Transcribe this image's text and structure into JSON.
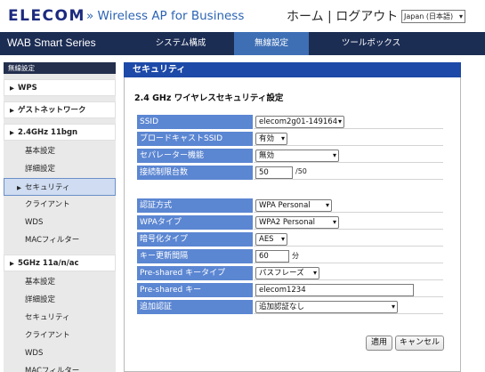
{
  "header": {
    "logo": "ELECOM",
    "product": "» Wireless AP for Business",
    "home": "ホーム",
    "separator": "|",
    "logout": "ログアウト",
    "language": "Japan (日本語)"
  },
  "nav": {
    "series": "WAB Smart Series",
    "tabs": [
      "システム構成",
      "無線設定",
      "ツールボックス"
    ],
    "active_tab": "無線設定"
  },
  "sidebar": {
    "title": "無線設定",
    "wps": "WPS",
    "guest": "ゲストネットワーク",
    "band24": "2.4GHz 11bgn",
    "band24_items": [
      "基本設定",
      "詳細設定",
      "セキュリティ",
      "クライアント",
      "WDS",
      "MACフィルター"
    ],
    "band5": "5GHz 11a/n/ac",
    "band5_items": [
      "基本設定",
      "詳細設定",
      "セキュリティ",
      "クライアント",
      "WDS",
      "MACフィルター"
    ],
    "active_item": "セキュリティ"
  },
  "panel": {
    "header": "セキュリティ",
    "section_title": "2.4 GHz ワイヤレスセキュリティ設定",
    "rows": [
      {
        "label": "SSID",
        "value": "elecom2g01-149164"
      },
      {
        "label": "ブロードキャストSSID",
        "value": "有効"
      },
      {
        "label": "セパレーター機能",
        "value": "無効"
      },
      {
        "label": "接続制限台数",
        "value": "50",
        "suffix": "/50"
      },
      {
        "label": "認証方式",
        "value": "WPA Personal"
      },
      {
        "label": "WPAタイプ",
        "value": "WPA2 Personal"
      },
      {
        "label": "暗号化タイプ",
        "value": "AES"
      },
      {
        "label": "キー更新間隔",
        "value": "60",
        "suffix": "分"
      },
      {
        "label": "Pre-shared キータイプ",
        "value": "パスフレーズ"
      },
      {
        "label": "Pre-shared キー",
        "value": "elecom1234"
      },
      {
        "label": "追加認証",
        "value": "追加認証なし"
      }
    ],
    "apply": "適用",
    "cancel": "キャンセル"
  },
  "icons": {
    "dropdown": "chevron-down-icon",
    "section": "triangle-right-icon"
  },
  "colors": {
    "nav_bg": "#1c2d54",
    "active_tab": "#3e6fb5",
    "panel_header": "#1d49a8",
    "label_bg": "#5b86d2",
    "logo": "#1c2a7e"
  }
}
